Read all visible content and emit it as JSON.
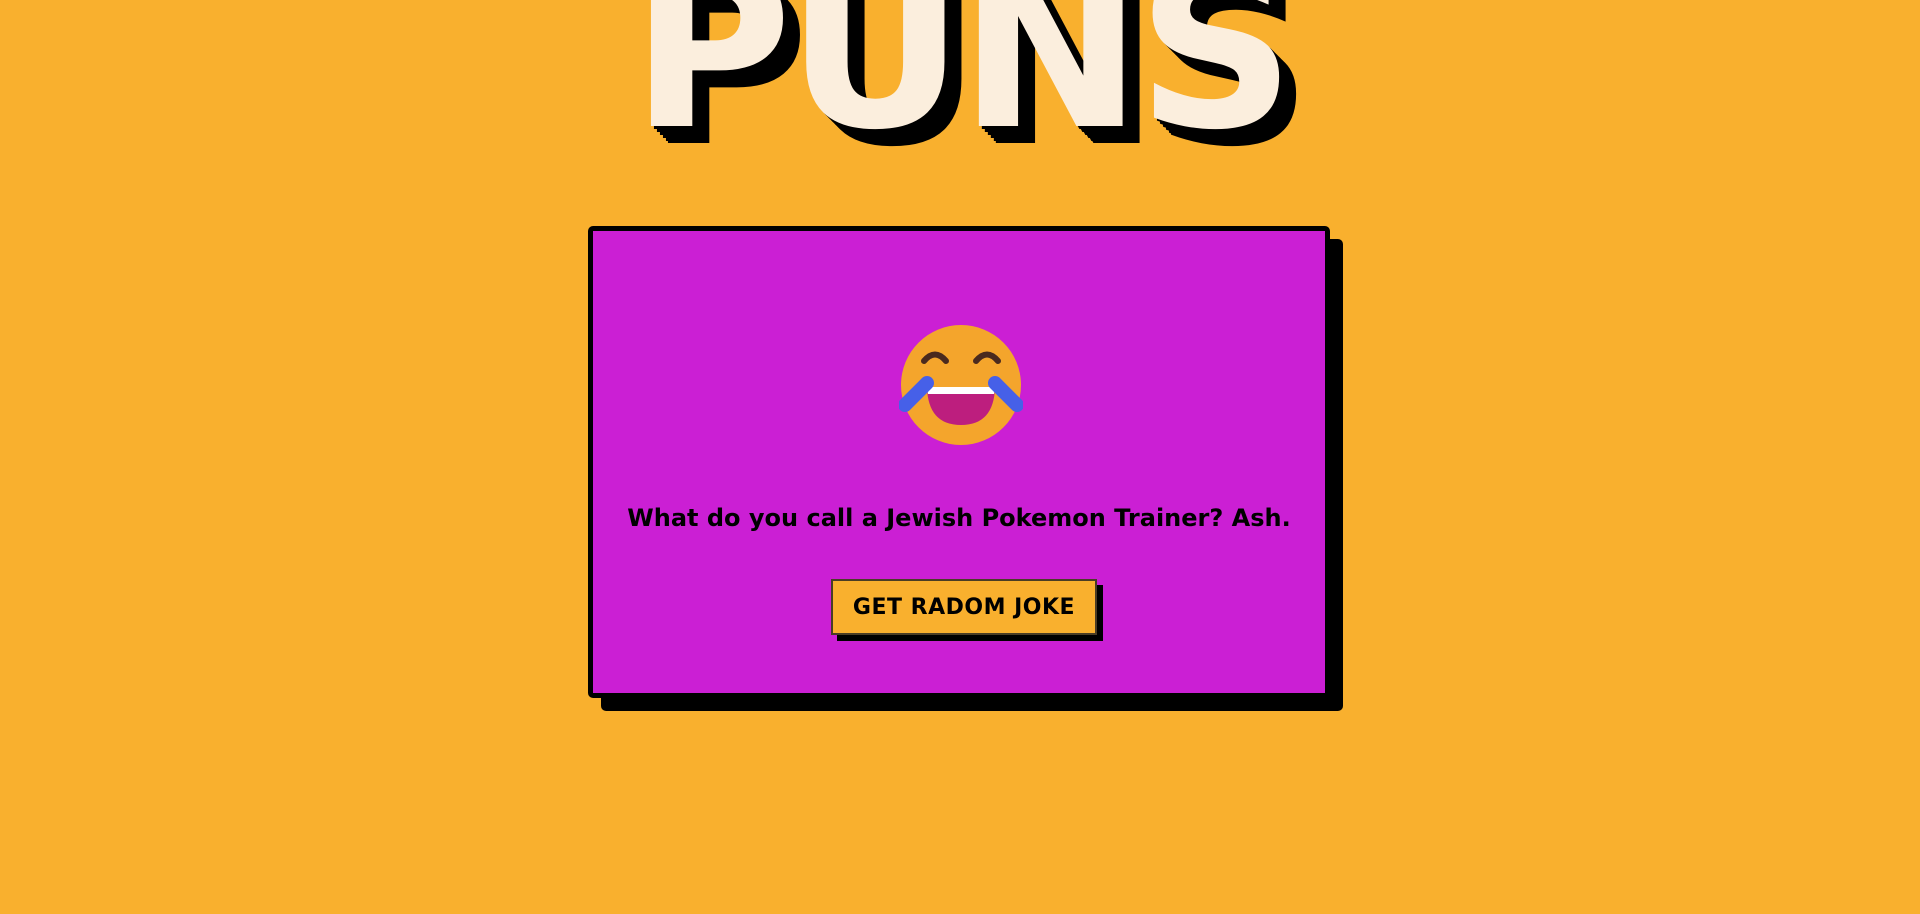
{
  "header": {
    "title": "PUNS"
  },
  "joke_card": {
    "emoji_icon": "face-with-tears-of-joy-icon",
    "joke_text": "What do you call a Jewish Pokemon Trainer? Ash.",
    "button_label": "GET RADOM JOKE"
  },
  "colors": {
    "page_background": "#F9B02E",
    "card_background": "#CB1FD4",
    "title_text": "#FBEEDD",
    "shadow": "#000000",
    "button_background": "#F9B02E"
  }
}
